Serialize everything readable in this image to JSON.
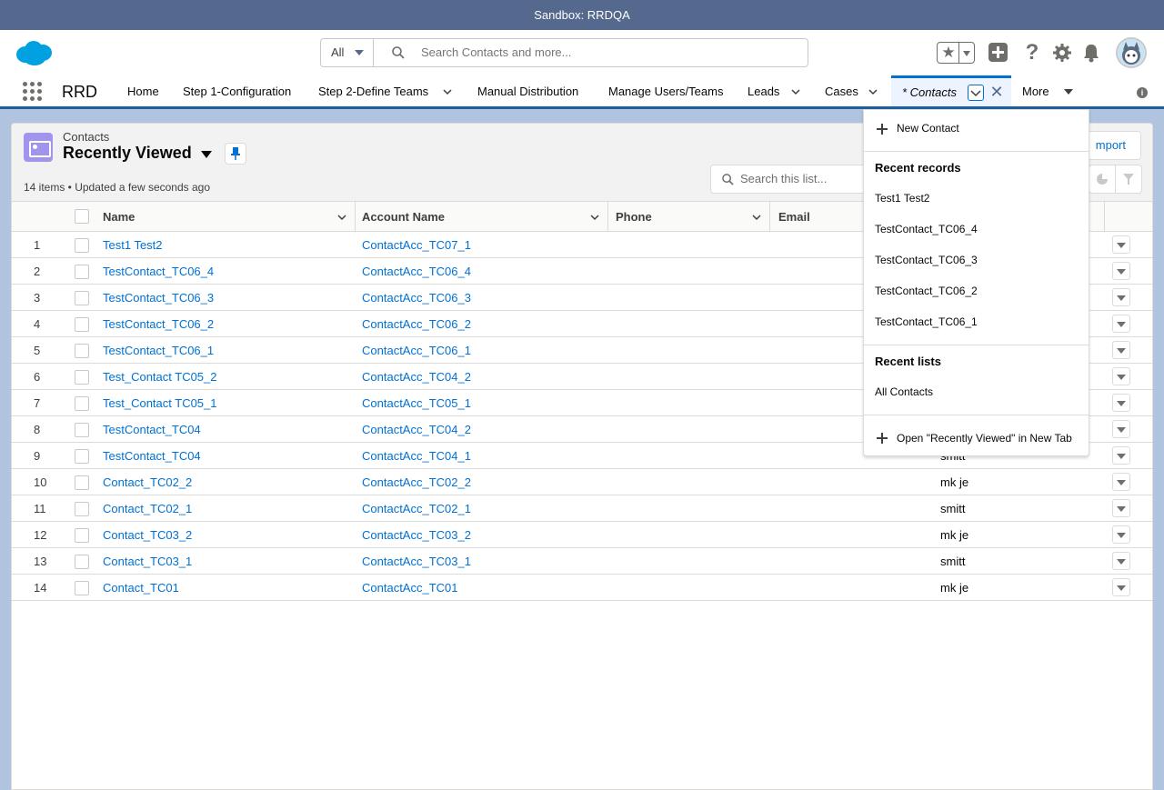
{
  "sandbox": {
    "label": "Sandbox: RRDQA"
  },
  "header": {
    "search_scope": "All",
    "search_placeholder": "Search Contacts and more...",
    "icons": [
      "salesforce-logo",
      "star-icon",
      "plus-icon",
      "help-icon",
      "gear-icon",
      "bell-icon",
      "avatar"
    ]
  },
  "nav": {
    "app_name": "RRD",
    "items": [
      {
        "label": "Home"
      },
      {
        "label": "Step 1-Configuration"
      },
      {
        "label": "Step 2-Define Teams"
      },
      {
        "label": "Manual Distribution"
      },
      {
        "label": "Manage Users/Teams"
      },
      {
        "label": "Leads"
      },
      {
        "label": "Cases"
      }
    ],
    "active_tab": "* Contacts",
    "more": "More"
  },
  "list": {
    "object_label": "Contacts",
    "title": "Recently Viewed",
    "meta": "14 items • Updated a few seconds ago",
    "search_placeholder": "Search this list...",
    "import_label": "mport"
  },
  "columns": {
    "name": "Name",
    "account": "Account Name",
    "phone": "Phone",
    "email": "Email"
  },
  "rows": [
    {
      "num": "1",
      "name": "Test1 Test2",
      "account": "ContactAcc_TC07_1",
      "owner": ""
    },
    {
      "num": "2",
      "name": "TestContact_TC06_4",
      "account": "ContactAcc_TC06_4",
      "owner": ""
    },
    {
      "num": "3",
      "name": "TestContact_TC06_3",
      "account": "ContactAcc_TC06_3",
      "owner": ""
    },
    {
      "num": "4",
      "name": "TestContact_TC06_2",
      "account": "ContactAcc_TC06_2",
      "owner": ""
    },
    {
      "num": "5",
      "name": "TestContact_TC06_1",
      "account": "ContactAcc_TC06_1",
      "owner": ""
    },
    {
      "num": "6",
      "name": "Test_Contact TC05_2",
      "account": "ContactAcc_TC04_2",
      "owner": ""
    },
    {
      "num": "7",
      "name": "Test_Contact TC05_1",
      "account": "ContactAcc_TC05_1",
      "owner": ""
    },
    {
      "num": "8",
      "name": "TestContact_TC04",
      "account": "ContactAcc_TC04_2",
      "owner": ""
    },
    {
      "num": "9",
      "name": "TestContact_TC04",
      "account": "ContactAcc_TC04_1",
      "owner": "smitt"
    },
    {
      "num": "10",
      "name": "Contact_TC02_2",
      "account": "ContactAcc_TC02_2",
      "owner": "mk je"
    },
    {
      "num": "11",
      "name": "Contact_TC02_1",
      "account": "ContactAcc_TC02_1",
      "owner": "smitt"
    },
    {
      "num": "12",
      "name": "Contact_TC03_2",
      "account": "ContactAcc_TC03_2",
      "owner": "mk je"
    },
    {
      "num": "13",
      "name": "Contact_TC03_1",
      "account": "ContactAcc_TC03_1",
      "owner": "smitt"
    },
    {
      "num": "14",
      "name": "Contact_TC01",
      "account": "ContactAcc_TC01",
      "owner": "mk je"
    }
  ],
  "dropdown": {
    "new_label": "New Contact",
    "recent_records_heading": "Recent records",
    "recent_records": [
      "Test1 Test2",
      "TestContact_TC06_4",
      "TestContact_TC06_3",
      "TestContact_TC06_2",
      "TestContact_TC06_1"
    ],
    "recent_lists_heading": "Recent lists",
    "recent_lists": [
      "All Contacts"
    ],
    "open_new_tab": "Open \"Recently Viewed\" in New Tab"
  },
  "colors": {
    "brand_blue": "#0070d2",
    "sandbox_bar": "#54698d",
    "contact_icon": "#a094ed"
  }
}
